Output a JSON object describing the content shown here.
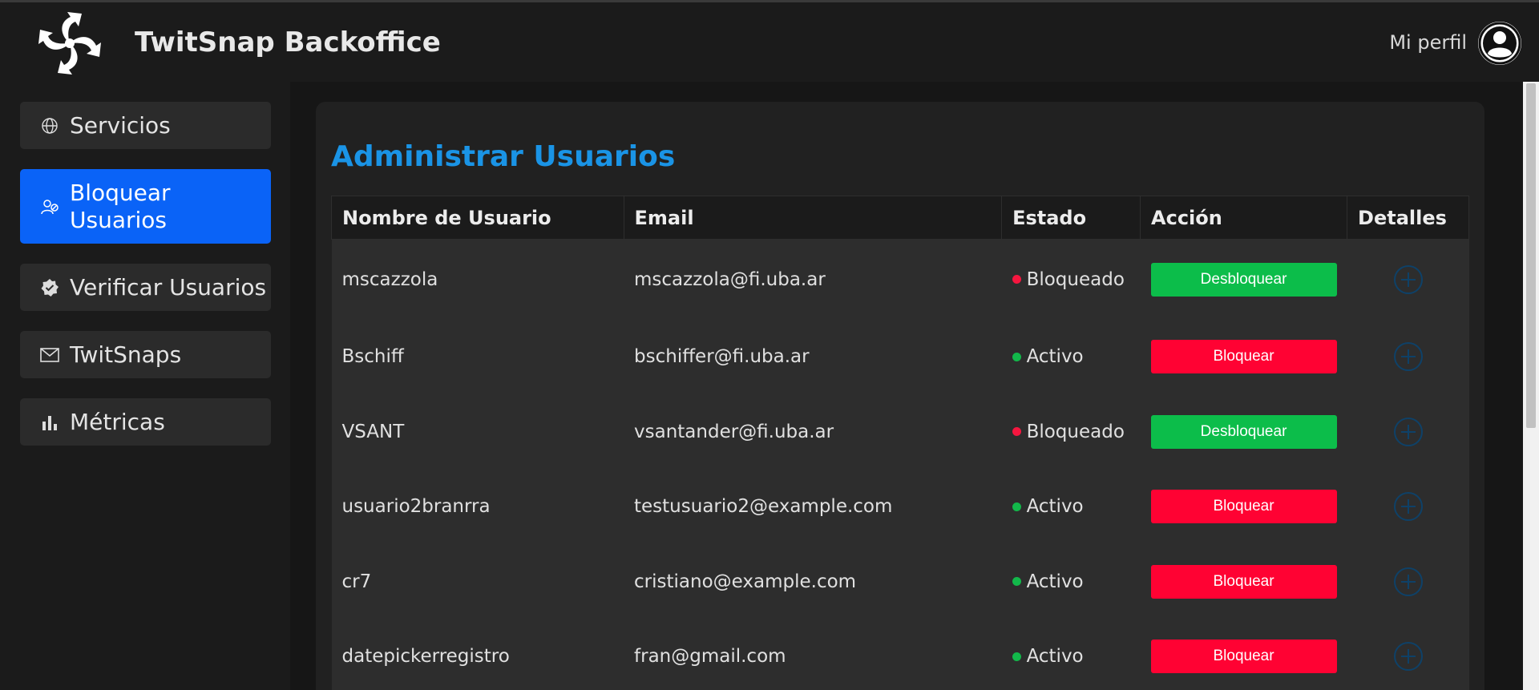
{
  "header": {
    "app_title": "TwitSnap Backoffice",
    "profile_label": "Mi perfil",
    "logo_icon": "swirl-logo-icon",
    "avatar_icon": "user-circle-icon"
  },
  "sidebar": {
    "items": [
      {
        "label": "Servicios",
        "icon": "globe-icon",
        "active": false
      },
      {
        "label": "Bloquear Usuarios",
        "icon": "user-block-icon",
        "active": true
      },
      {
        "label": "Verificar Usuarios",
        "icon": "verified-badge-icon",
        "active": false
      },
      {
        "label": "TwitSnaps",
        "icon": "envelope-icon",
        "active": false
      },
      {
        "label": "Métricas",
        "icon": "bar-chart-icon",
        "active": false
      }
    ]
  },
  "main": {
    "title": "Administrar Usuarios",
    "columns": [
      "Nombre de Usuario",
      "Email",
      "Estado",
      "Acción",
      "Detalles"
    ],
    "rows": [
      {
        "username": "mscazzola",
        "email": "mscazzola@fi.uba.ar",
        "status": "Bloqueado",
        "action": "Desbloquear"
      },
      {
        "username": "Bschiff",
        "email": "bschiffer@fi.uba.ar",
        "status": "Activo",
        "action": "Bloquear"
      },
      {
        "username": "VSANT",
        "email": "vsantander@fi.uba.ar",
        "status": "Bloqueado",
        "action": "Desbloquear"
      },
      {
        "username": "usuario2branrra",
        "email": "testusuario2@example.com",
        "status": "Activo",
        "action": "Bloquear"
      },
      {
        "username": "cr7",
        "email": "cristiano@example.com",
        "status": "Activo",
        "action": "Bloquear"
      },
      {
        "username": "datepickerregistro",
        "email": "fran@gmail.com",
        "status": "Activo",
        "action": "Bloquear"
      }
    ]
  },
  "colors": {
    "accent": "#1a94e6",
    "active_nav": "#0a63f7",
    "status_blocked": "#f5163f",
    "status_active": "#12b84a",
    "unblock_button": "#0cbd4a",
    "block_button": "#ff0233"
  }
}
